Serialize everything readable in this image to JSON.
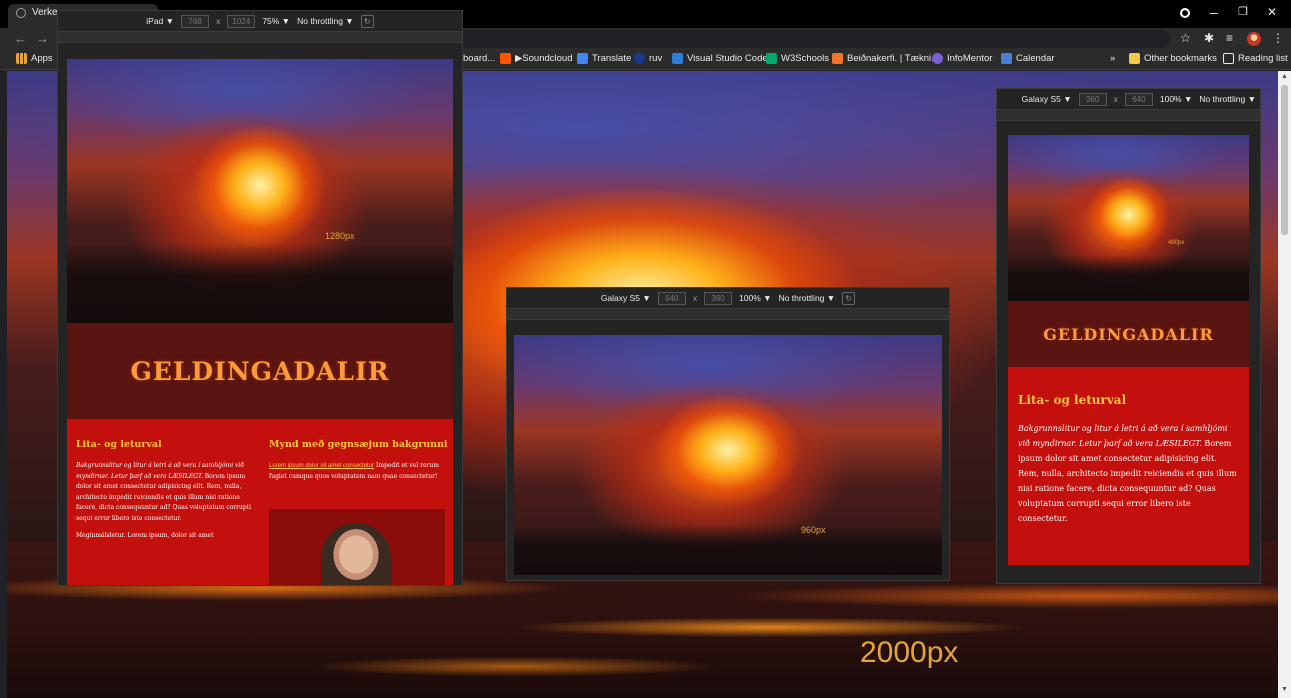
{
  "browser": {
    "tab_title": "Verke",
    "window_controls": {
      "minimize": "–",
      "restore": "❐",
      "close": "✕"
    },
    "nav": {
      "back": "←",
      "forward": "→"
    },
    "toolbar_icons": {
      "star": "☆",
      "extensions": "✱",
      "queue": "≡"
    },
    "bookmarks": [
      {
        "label": "Apps",
        "icon": "apps-grid-icon",
        "color": "#e8a33a"
      },
      {
        "label": "board...",
        "icon": "",
        "color": ""
      },
      {
        "label": "▶Soundcloud",
        "icon": "soundcloud-icon",
        "color": "#ff5500"
      },
      {
        "label": "Translate",
        "icon": "translate-icon",
        "color": "#4285f4"
      },
      {
        "label": "ruv",
        "icon": "ruv-icon",
        "color": "#1a3a8a"
      },
      {
        "label": "Visual Studio Code",
        "icon": "vscode-icon",
        "color": "#2f7fd8"
      },
      {
        "label": "W3Schools",
        "icon": "w3schools-icon",
        "color": "#04aa6d"
      },
      {
        "label": "Beiðnakerfi. | Tækni...",
        "icon": "orange-icon",
        "color": "#f0762a"
      },
      {
        "label": "InfoMentor",
        "icon": "infomentor-icon",
        "color": "#7a5fd0"
      },
      {
        "label": "Calendar",
        "icon": "calendar-icon",
        "color": "#4a7fd8"
      }
    ],
    "bookmarks_overflow": "»",
    "other_bookmarks": "Other bookmarks",
    "reading_list": "Reading list"
  },
  "page_background": {
    "label": "2000px"
  },
  "devices": {
    "ipad": {
      "device_name": "iPad ▼",
      "width": "768",
      "height": "1024",
      "x": "x",
      "zoom": "75% ▼",
      "throttling": "No throttling ▼",
      "rotate": "↻",
      "hero_label": "1280px",
      "site_title": "GELDINGADALIR",
      "col1_heading": "Lita- og leturval",
      "col1_italic": "Bakgrunnslitur og litur á letri á að vera í samhljómi við myndirnar. Letur þarf að vera LÆSILEGT.",
      "col1_text": "Borem ipsum dolor sit amet consectetur adipisicing elit. Rem, nulla, architecto impedit reiciendis et quis illum nisi ratione facere, dicta consequuntur ad? Quas voluptatum corrupti sequi error libero iste consectetur.",
      "col1_text2": "Meginmálsletur. Lorem ipsum, dolor sit amet",
      "col2_heading": "Mynd með gegnsæjum bakgrunni",
      "col2_link": "Lorem ipsum dolor sit amet consectetur",
      "col2_text": " Impedit et vel rerum fugiat cumque quos voluptatem nam quae consectetur!"
    },
    "galaxy_landscape": {
      "device_name": "Galaxy S5 ▼",
      "width": "640",
      "height": "360",
      "x": "x",
      "zoom": "100% ▼",
      "throttling": "No throttling ▼",
      "rotate": "↻",
      "hero_label": "960px"
    },
    "galaxy_portrait": {
      "device_name": "Galaxy S5 ▼",
      "width": "360",
      "height": "640",
      "x": "x",
      "zoom": "100% ▼",
      "throttling": "No throttling ▼",
      "hero_label": "480px",
      "site_title": "GELDINGADALIR",
      "heading": "Lita- og leturval",
      "italic": "Bakgrunnslitur og litur á letri á að vera í samhljómi við myndirnar. Letur þarf að vera LÆSILEGT.",
      "text": " Borem ipsum dolor sit amet consectetur adipisicing elit. Rem, nulla, architecto impedit reiciendis et quis illum nisi ratione facere, dicta consequuntur ad? Quas voluptatum corrupti sequi error libero iste consectetur."
    }
  }
}
